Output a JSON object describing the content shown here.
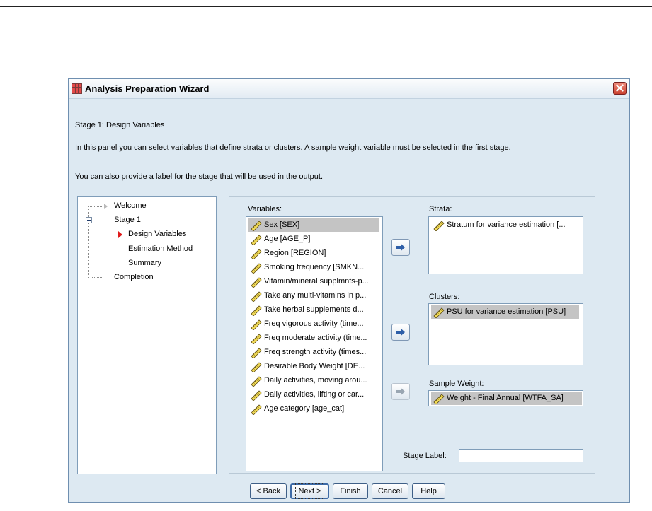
{
  "window": {
    "title": "Analysis Preparation Wizard"
  },
  "header": {
    "stage_title": "Stage 1: Design Variables",
    "description_1": "In this panel you can select variables that define strata or clusters. A sample weight variable must be selected in the first stage.",
    "description_2": "You can also provide a label for the stage that will be used in the output."
  },
  "tree": {
    "items": [
      {
        "label": "Welcome"
      },
      {
        "label": "Stage 1"
      },
      {
        "label": "Design Variables"
      },
      {
        "label": "Estimation Method"
      },
      {
        "label": "Summary"
      },
      {
        "label": "Completion"
      }
    ]
  },
  "variables": {
    "label": "Variables:",
    "items": [
      "Sex [SEX]",
      "Age [AGE_P]",
      "Region [REGION]",
      "Smoking frequency [SMKN...",
      "Vitamin/mineral supplmnts-p...",
      "Take any multi-vitamins in p...",
      "Take herbal supplements d...",
      "Freq vigorous activity (time...",
      "Freq moderate activity (time...",
      "Freq strength activity (times...",
      "Desirable Body Weight [DE...",
      "Daily activities, moving arou...",
      "Daily activities, lifting or car...",
      "Age category [age_cat]"
    ],
    "selected_index": 0
  },
  "strata": {
    "label": "Strata:",
    "items": [
      "Stratum for variance estimation [..."
    ]
  },
  "clusters": {
    "label": "Clusters:",
    "items": [
      "PSU for variance estimation [PSU]"
    ]
  },
  "sample_weight": {
    "label": "Sample Weight:",
    "value": "Weight - Final Annual [WTFA_SA]"
  },
  "stage_label": {
    "label": "Stage Label:",
    "value": ""
  },
  "buttons": {
    "back": "< Back",
    "next": "Next >",
    "finish": "Finish",
    "cancel": "Cancel",
    "help": "Help"
  },
  "colors": {
    "dialog_bg": "#dde9f2",
    "selected_row": "#c4c4c4",
    "arrow_icon": "#2f5fa8"
  }
}
